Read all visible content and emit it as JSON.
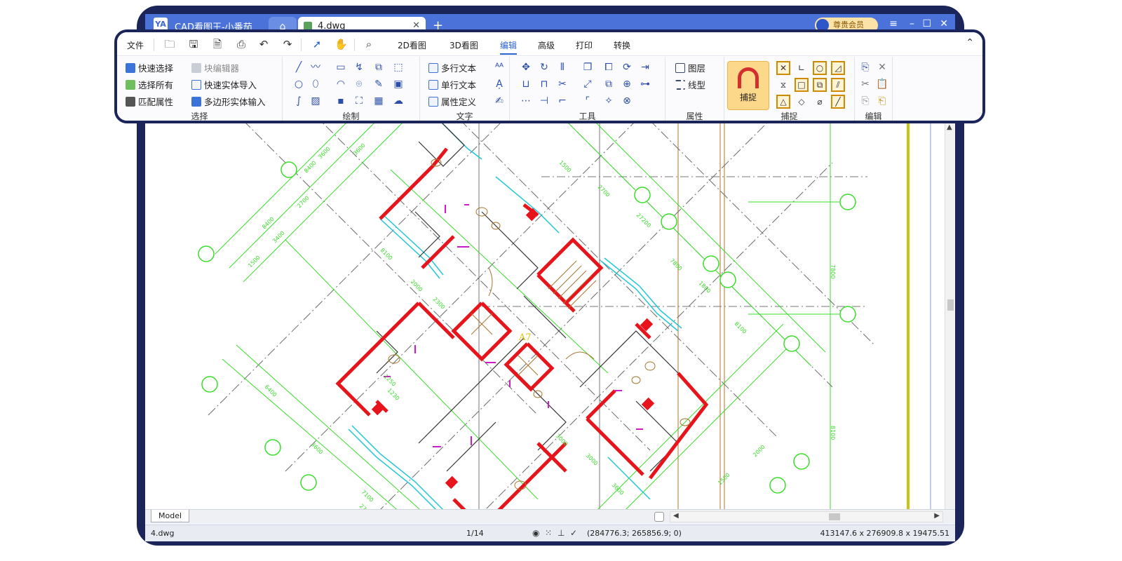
{
  "window": {
    "app_title": "CAD看图王-小番茄",
    "app_logo_text": "YA",
    "home_icon": "home-icon",
    "doc_tab_name": "4.dwg",
    "new_tab": "+",
    "vip_label": "尊贵会员",
    "controls": [
      "≡",
      "–",
      "☐",
      "✕"
    ]
  },
  "menu": {
    "file": "文件",
    "tabs": [
      "2D看图",
      "3D看图",
      "编辑",
      "高级",
      "打印",
      "转换"
    ],
    "active_tab": "编辑",
    "toolbar_icons": [
      "open-file-icon",
      "save-icon",
      "save-pdf-icon",
      "print-icon",
      "undo-icon",
      "redo-icon",
      "select-arrow-icon",
      "pan-hand-icon",
      "zoom-search-icon"
    ],
    "collapse_icon": "collapse-up-icon"
  },
  "ribbon": {
    "select": {
      "label": "选择",
      "items": [
        "快速选择",
        "块编辑器",
        "选择所有",
        "快速实体导入",
        "匹配属性",
        "多边形实体输入"
      ]
    },
    "draw": {
      "label": "绘制"
    },
    "text": {
      "label": "文字",
      "items": [
        "多行文本",
        "单行文本",
        "属性定义"
      ]
    },
    "tools": {
      "label": "工具"
    },
    "properties": {
      "label": "属性",
      "items": [
        "图层",
        "线型"
      ]
    },
    "snap": {
      "label": "捕捉",
      "button": "捕捉"
    },
    "edit": {
      "label": "编辑"
    }
  },
  "drawing": {
    "annotation": "A7",
    "dims": [
      "8400",
      "3600",
      "3600",
      "2700",
      "2000",
      "1500",
      "3400",
      "2300",
      "27200",
      "7800",
      "8100",
      "1800",
      "6400",
      "3600",
      "1500",
      "2700",
      "8100",
      "7100",
      "3000",
      "27200",
      "1250",
      "1230",
      "3600",
      "3000",
      "2000",
      "7100",
      "27200"
    ]
  },
  "bottom": {
    "model_tab": "Model",
    "file_name": "4.dwg",
    "page": "1/14",
    "coords": "(284776.3; 265856.9; 0)",
    "extents": "413147.6 x 276909.8 x 19475.51"
  },
  "colors": {
    "frame": "#1b2559",
    "titlebar": "#4a72d8",
    "accent": "#2a63d8",
    "wall": "#e8141b",
    "dimension": "#3adc2a",
    "fixture": "#a8742c",
    "window_line": "#1ec6d8",
    "magenta": "#d019c9",
    "grid_line": "#6b6b6b"
  }
}
